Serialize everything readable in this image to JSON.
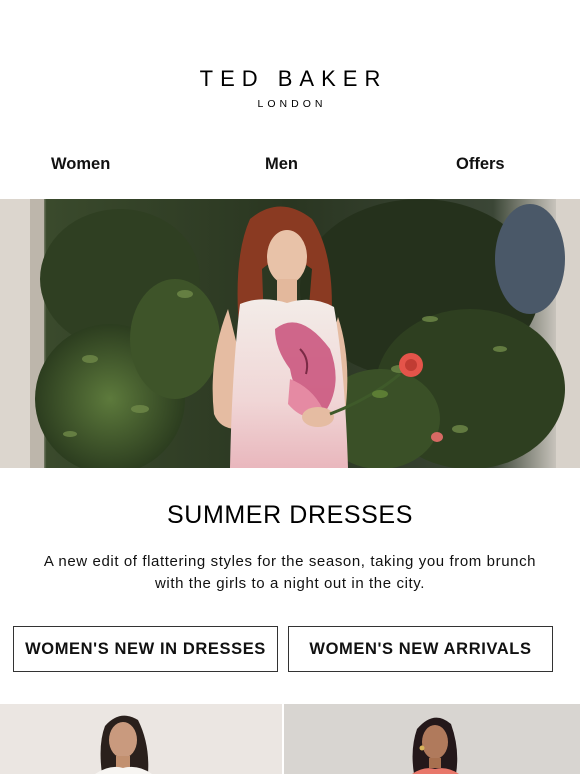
{
  "brand": {
    "name": "TED BAKER",
    "sub": "LONDON"
  },
  "nav": {
    "items": [
      {
        "label": "Women"
      },
      {
        "label": "Men"
      },
      {
        "label": "Offers"
      }
    ]
  },
  "hero": {
    "image": "woman in floral-print sleeveless dress holding a rose in a garden"
  },
  "section": {
    "title": "SUMMER DRESSES",
    "description": "A new edit of flattering styles for the season, taking you from brunch with the girls to a night out in the city."
  },
  "buttons": {
    "new_in_dresses": "WOMEN'S NEW IN DRESSES",
    "new_arrivals": "WOMEN'S NEW ARRIVALS"
  },
  "products": [
    {
      "image": "model in white top"
    },
    {
      "image": "model in coral top"
    }
  ]
}
